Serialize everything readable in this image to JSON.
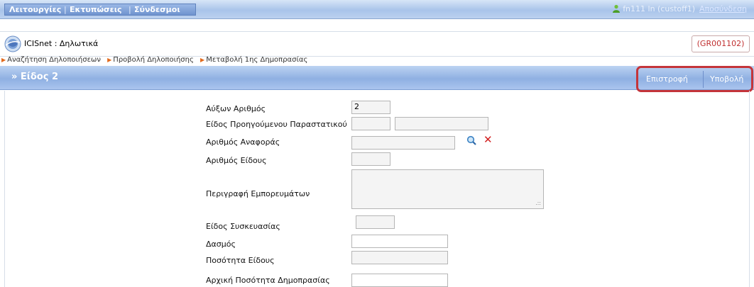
{
  "menu": {
    "items": [
      "Λειτουργίες",
      "Εκτυπώσεις",
      "Σύνδεσμοι"
    ]
  },
  "user": {
    "name": "fn111 ln (custoff1)",
    "logout": "Αποσύνδεση",
    "icon": "user-icon"
  },
  "app": {
    "title": "ICISnet : Δηλωτικά",
    "ref": "(GR001102)",
    "logo": "globe-icon"
  },
  "breadcrumb": {
    "items": [
      "Αναζήτηση Δηλοποιήσεων",
      "Προβολή Δηλοποιήσης",
      "Μεταβολή 1ης Δημοπρασίας"
    ]
  },
  "section": {
    "title": "» Είδος 2",
    "back_label": "Επιστροφή",
    "submit_label": "Υποβολή"
  },
  "form": {
    "serial_label": "Αύξων Αριθμός",
    "serial_value": "2",
    "prev_doc_label": "Είδος Προηγούμενου Παραστατικού",
    "ref_number_label": "Αριθμός Αναφοράς",
    "item_number_label": "Αριθμός Είδους",
    "goods_desc_label": "Περιγραφή Εμπορευμάτων",
    "packaging_label": "Είδος Συσκευασίας",
    "duty_label": "Δασμός",
    "quantity_label": "Ποσότητα Είδους",
    "initial_qty_label": "Αρχική Ποσότητα Δημοπρασίας"
  },
  "colors": {
    "highlight": "#c4343a",
    "ref_text": "#c03030",
    "breadcrumb_arrow": "#e26b1e",
    "delete_icon": "#d21f1f"
  }
}
